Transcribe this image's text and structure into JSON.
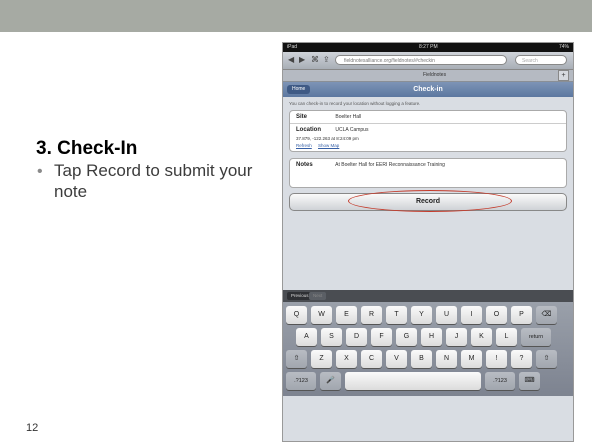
{
  "slide": {
    "title": "3. Check-In",
    "bullet_marker": "•",
    "bullet_text": "Tap Record to submit your note",
    "slide_number": "12",
    "band_color": "#a6aaa3"
  },
  "ipad": {
    "status": {
      "carrier": "iPad",
      "time": "8:27 PM",
      "battery": "74%"
    },
    "browser": {
      "url": "fieldnotesalliance.org/fieldnotes/#checkin",
      "search_placeholder": "Search",
      "back_icon": "back-arrow-icon",
      "forward_icon": "forward-arrow-icon"
    },
    "tab": {
      "label": "Fieldnotes",
      "add_symbol": "+"
    },
    "header": {
      "home_label": "Home",
      "title": "Check-in"
    },
    "hint_text": "You can check-in to record your location without logging a feature.",
    "site": {
      "label": "Site",
      "value": "Boelter Hall"
    },
    "location": {
      "label": "Location",
      "value": "UCLA Campus",
      "coords": "37.879, -122.263 at 8:24:09 pm",
      "refresh_label": "Refresh",
      "map_label": "Show Map"
    },
    "notes": {
      "label": "Notes",
      "value": "At Boelter Hall for EERI Reconnaissance Training"
    },
    "record_label": "Record",
    "accent_color": "#c43a2a",
    "keyboard": {
      "toolbar": {
        "previous": "Previous",
        "next": "Next"
      },
      "row1": [
        "Q",
        "W",
        "E",
        "R",
        "T",
        "Y",
        "U",
        "I",
        "O",
        "P"
      ],
      "row2": [
        "A",
        "S",
        "D",
        "F",
        "G",
        "H",
        "J",
        "K",
        "L"
      ],
      "row3": [
        "Z",
        "X",
        "C",
        "V",
        "B",
        "N",
        "M",
        "!",
        "?"
      ],
      "return_label": "return",
      "numbers_label": ".?123",
      "backspace_icon": "backspace-icon",
      "shift_icon": "shift-icon",
      "mic_icon": "microphone-icon",
      "hide_keyboard_icon": "hide-keyboard-icon"
    }
  }
}
